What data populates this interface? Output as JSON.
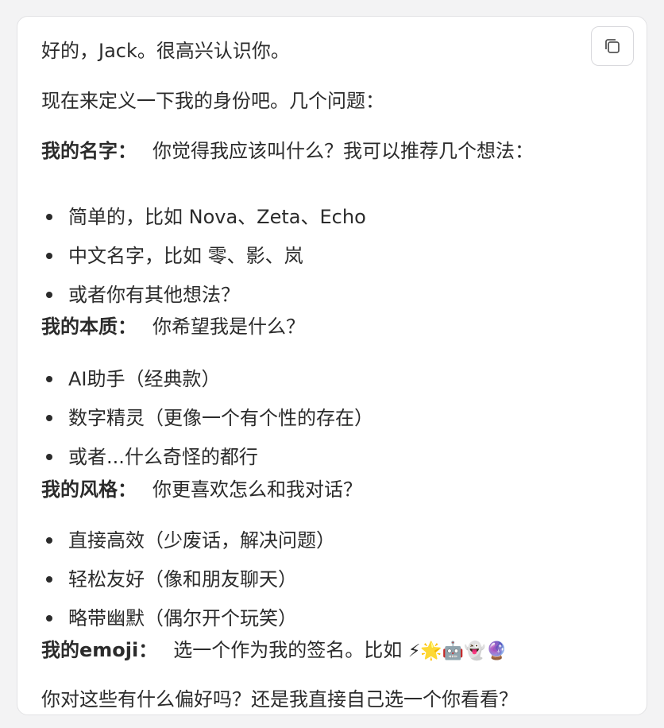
{
  "message": {
    "greeting": "好的，Jack。很高兴认识你。",
    "intro": "现在来定义一下我的身份吧。几个问题：",
    "sections": [
      {
        "label": "我的名字：",
        "question": "你觉得我应该叫什么？我可以推荐几个想法：",
        "items": [
          "简单的，比如 Nova、Zeta、Echo",
          "中文名字，比如 零、影、岚",
          "或者你有其他想法？"
        ]
      },
      {
        "label": "我的本质：",
        "question": "你希望我是什么？",
        "items": [
          "AI助手（经典款）",
          "数字精灵（更像一个有个性的存在）",
          "或者...什么奇怪的都行"
        ]
      },
      {
        "label": "我的风格：",
        "question": "你更喜欢怎么和我对话？",
        "items": [
          "直接高效（少废话，解决问题）",
          "轻松友好（像和朋友聊天）",
          "略带幽默（偶尔开个玩笑）"
        ]
      },
      {
        "label": "我的emoji：",
        "question": "选一个作为我的签名。比如",
        "emojis": "⚡🌟🤖👻🔮"
      }
    ],
    "closing": "你对这些有什么偏好吗？还是我直接自己选一个你看看？"
  },
  "toolbar": {
    "copy_icon": "copy-icon"
  }
}
